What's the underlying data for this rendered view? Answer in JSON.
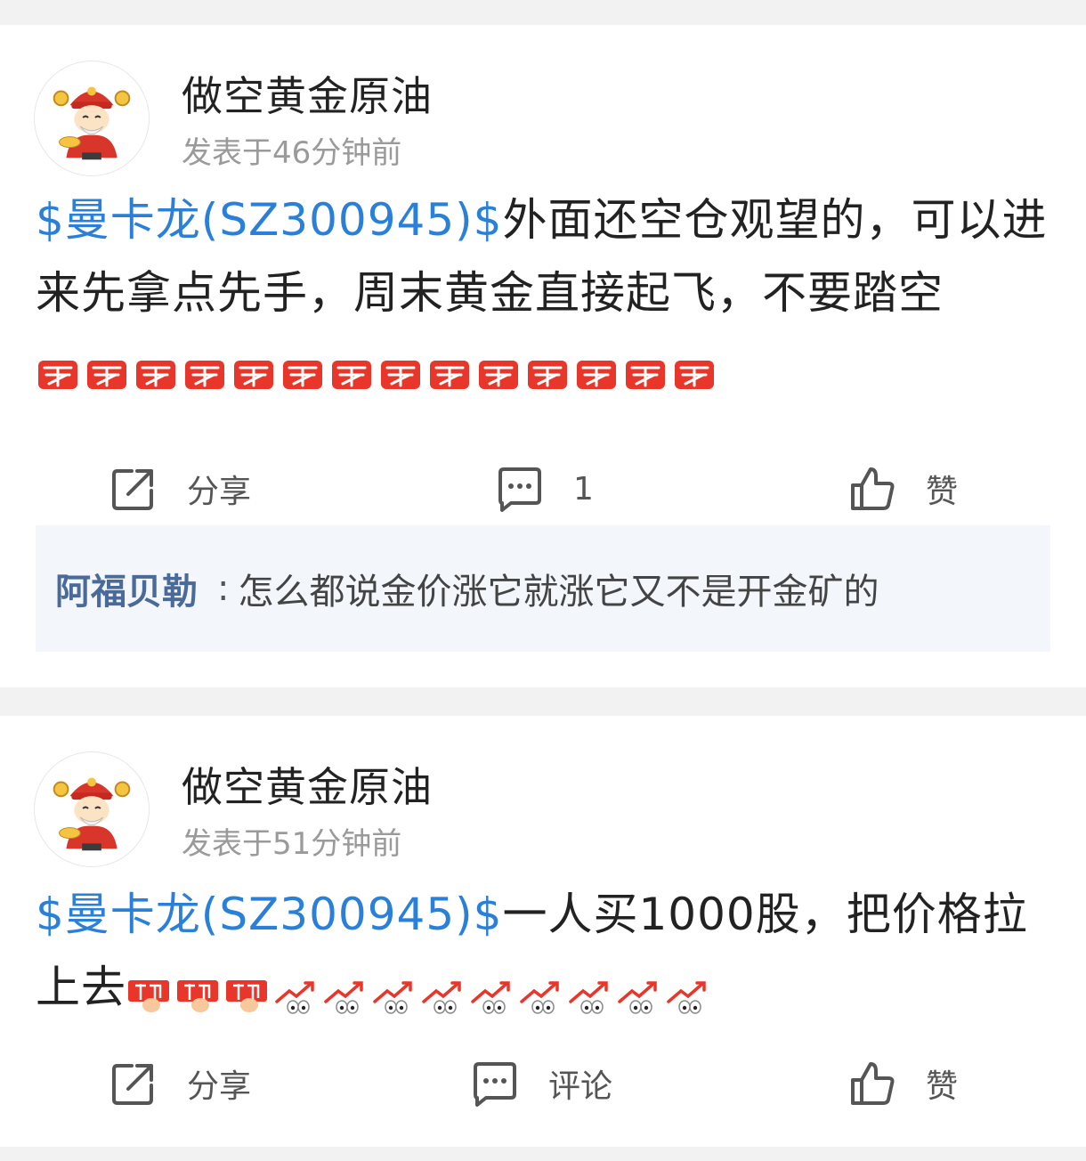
{
  "colors": {
    "stock_link": "#2a7fd8",
    "commenter_name": "#4a6a9a",
    "comment_bg": "#f3f7fb",
    "page_bg": "#f2f2f2"
  },
  "posts": [
    {
      "author": "做空黄金原油",
      "time": "发表于46分钟前",
      "stock_tag": "$曼卡龙(SZ300945)$",
      "text": "外面还空仓观望的，可以进来先拿点先手，周末黄金直接起飞，不要踏空",
      "emojis": [
        "buy-emoji",
        "buy-emoji",
        "buy-emoji",
        "buy-emoji",
        "buy-emoji",
        "buy-emoji",
        "buy-emoji",
        "buy-emoji",
        "buy-emoji",
        "buy-emoji",
        "buy-emoji",
        "buy-emoji",
        "buy-emoji",
        "buy-emoji"
      ],
      "actions": {
        "share_label": "分享",
        "comment_label": "1",
        "like_label": "赞",
        "share_icon": "share-icon",
        "comment_icon": "comment-icon",
        "like_icon": "thumbs-up-icon"
      },
      "comments": [
        {
          "user": "阿福贝勒",
          "text": "怎么都说金价涨它就涨它又不是开金矿的"
        }
      ]
    },
    {
      "author": "做空黄金原油",
      "time": "发表于51分钟前",
      "stock_tag": "$曼卡龙(SZ300945)$",
      "text": "一人买1000股，把价格拉上去",
      "emojis": [
        "grab-emoji",
        "grab-emoji",
        "grab-emoji",
        "rising-eyes-emoji",
        "rising-eyes-emoji",
        "rising-eyes-emoji",
        "rising-eyes-emoji",
        "rising-eyes-emoji",
        "rising-eyes-emoji",
        "rising-eyes-emoji",
        "rising-eyes-emoji",
        "rising-eyes-emoji"
      ],
      "actions": {
        "share_label": "分享",
        "comment_label": "评论",
        "like_label": "赞",
        "share_icon": "share-icon",
        "comment_icon": "comment-icon",
        "like_icon": "thumbs-up-icon"
      },
      "comments": []
    }
  ]
}
